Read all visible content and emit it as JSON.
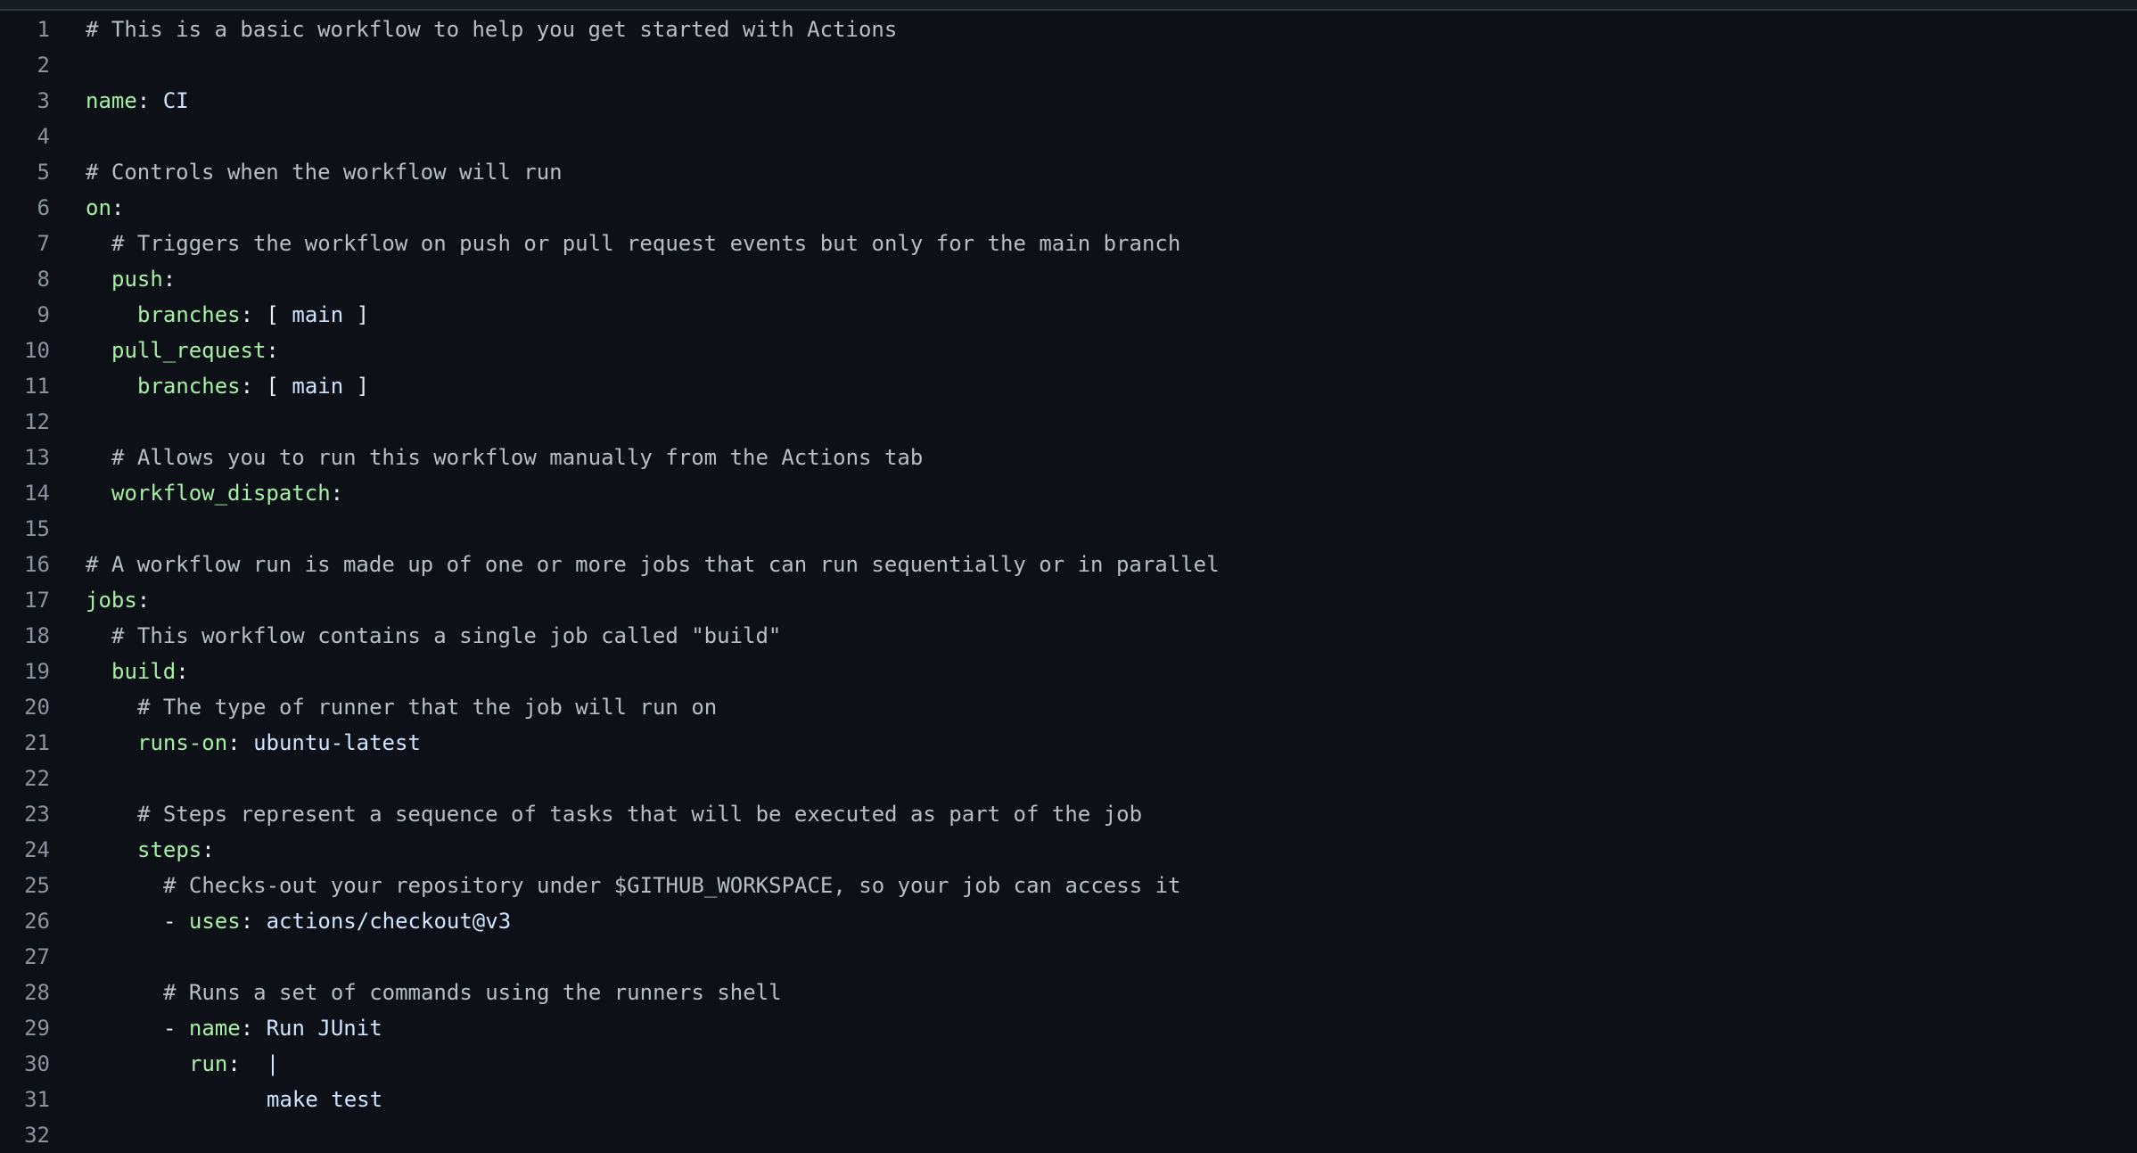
{
  "editor": {
    "lines": [
      {
        "n": "1",
        "indent": 0,
        "parts": [
          [
            "comment",
            "# This is a basic workflow to help you get started with Actions"
          ]
        ]
      },
      {
        "n": "2",
        "indent": 0,
        "parts": []
      },
      {
        "n": "3",
        "indent": 0,
        "parts": [
          [
            "key",
            "name"
          ],
          [
            "punct",
            ": "
          ],
          [
            "value",
            "CI"
          ]
        ]
      },
      {
        "n": "4",
        "indent": 0,
        "parts": []
      },
      {
        "n": "5",
        "indent": 0,
        "parts": [
          [
            "comment",
            "# Controls when the workflow will run"
          ]
        ]
      },
      {
        "n": "6",
        "indent": 0,
        "parts": [
          [
            "key",
            "on"
          ],
          [
            "punct",
            ":"
          ]
        ]
      },
      {
        "n": "7",
        "indent": 2,
        "parts": [
          [
            "comment",
            "# Triggers the workflow on push or pull request events but only for the main branch"
          ]
        ]
      },
      {
        "n": "8",
        "indent": 2,
        "parts": [
          [
            "key",
            "push"
          ],
          [
            "punct",
            ":"
          ]
        ]
      },
      {
        "n": "9",
        "indent": 4,
        "parts": [
          [
            "key",
            "branches"
          ],
          [
            "punct",
            ": [ "
          ],
          [
            "value",
            "main"
          ],
          [
            "punct",
            " ]"
          ]
        ]
      },
      {
        "n": "10",
        "indent": 2,
        "parts": [
          [
            "key",
            "pull_request"
          ],
          [
            "punct",
            ":"
          ]
        ]
      },
      {
        "n": "11",
        "indent": 4,
        "parts": [
          [
            "key",
            "branches"
          ],
          [
            "punct",
            ": [ "
          ],
          [
            "value",
            "main"
          ],
          [
            "punct",
            " ]"
          ]
        ]
      },
      {
        "n": "12",
        "indent": 0,
        "parts": []
      },
      {
        "n": "13",
        "indent": 2,
        "parts": [
          [
            "comment",
            "# Allows you to run this workflow manually from the Actions tab"
          ]
        ]
      },
      {
        "n": "14",
        "indent": 2,
        "parts": [
          [
            "key",
            "workflow_dispatch"
          ],
          [
            "punct",
            ":"
          ]
        ]
      },
      {
        "n": "15",
        "indent": 0,
        "parts": []
      },
      {
        "n": "16",
        "indent": 0,
        "parts": [
          [
            "comment",
            "# A workflow run is made up of one or more jobs that can run sequentially or in parallel"
          ]
        ]
      },
      {
        "n": "17",
        "indent": 0,
        "parts": [
          [
            "key",
            "jobs"
          ],
          [
            "punct",
            ":"
          ]
        ]
      },
      {
        "n": "18",
        "indent": 2,
        "parts": [
          [
            "comment",
            "# This workflow contains a single job called \"build\""
          ]
        ]
      },
      {
        "n": "19",
        "indent": 2,
        "parts": [
          [
            "key",
            "build"
          ],
          [
            "punct",
            ":"
          ]
        ]
      },
      {
        "n": "20",
        "indent": 4,
        "parts": [
          [
            "comment",
            "# The type of runner that the job will run on"
          ]
        ]
      },
      {
        "n": "21",
        "indent": 4,
        "parts": [
          [
            "key",
            "runs-on"
          ],
          [
            "punct",
            ": "
          ],
          [
            "value",
            "ubuntu-latest"
          ]
        ]
      },
      {
        "n": "22",
        "indent": 0,
        "parts": []
      },
      {
        "n": "23",
        "indent": 4,
        "parts": [
          [
            "comment",
            "# Steps represent a sequence of tasks that will be executed as part of the job"
          ]
        ]
      },
      {
        "n": "24",
        "indent": 4,
        "parts": [
          [
            "key",
            "steps"
          ],
          [
            "punct",
            ":"
          ]
        ]
      },
      {
        "n": "25",
        "indent": 6,
        "parts": [
          [
            "comment",
            "# Checks-out your repository under $GITHUB_WORKSPACE, so your job can access it"
          ]
        ]
      },
      {
        "n": "26",
        "indent": 6,
        "parts": [
          [
            "dash",
            "- "
          ],
          [
            "key",
            "uses"
          ],
          [
            "punct",
            ": "
          ],
          [
            "value",
            "actions/checkout@v3"
          ]
        ]
      },
      {
        "n": "27",
        "indent": 0,
        "parts": []
      },
      {
        "n": "28",
        "indent": 6,
        "parts": [
          [
            "comment",
            "# Runs a set of commands using the runners shell"
          ]
        ]
      },
      {
        "n": "29",
        "indent": 6,
        "parts": [
          [
            "dash",
            "- "
          ],
          [
            "key",
            "name"
          ],
          [
            "punct",
            ": "
          ],
          [
            "value",
            "Run JUnit"
          ]
        ]
      },
      {
        "n": "30",
        "indent": 8,
        "parts": [
          [
            "key",
            "run"
          ],
          [
            "punct",
            ":  "
          ],
          [
            "value",
            "|"
          ]
        ]
      },
      {
        "n": "31",
        "indent": 14,
        "parts": [
          [
            "plain",
            "make test"
          ]
        ]
      },
      {
        "n": "32",
        "indent": 0,
        "parts": []
      }
    ]
  }
}
